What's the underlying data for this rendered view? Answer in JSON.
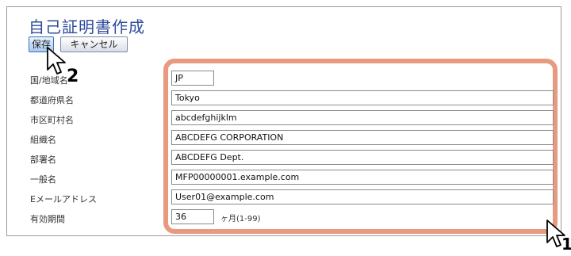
{
  "page": {
    "title": "自己証明書作成"
  },
  "toolbar": {
    "save_label": "保存",
    "cancel_label": "キャンセル"
  },
  "form": {
    "rows": [
      {
        "label": "国/地域名",
        "value": "JP"
      },
      {
        "label": "都道府県名",
        "value": "Tokyo"
      },
      {
        "label": "市区町村名",
        "value": "abcdefghijklm"
      },
      {
        "label": "組織名",
        "value": "ABCDEFG CORPORATION"
      },
      {
        "label": "部署名",
        "value": "ABCDEFG Dept."
      },
      {
        "label": "一般名",
        "value": "MFP00000001.example.com"
      },
      {
        "label": "Eメールアドレス",
        "value": "User01@example.com"
      },
      {
        "label": "有効期間",
        "value": "36"
      }
    ],
    "validity_unit": "ヶ月(1-99)"
  },
  "callouts": {
    "step_1": "1",
    "step_2": "2"
  },
  "colors": {
    "title": "#2e4a9c",
    "highlight": "#e79a80"
  },
  "icons": {
    "pointer": "mouse-pointer-icon"
  }
}
